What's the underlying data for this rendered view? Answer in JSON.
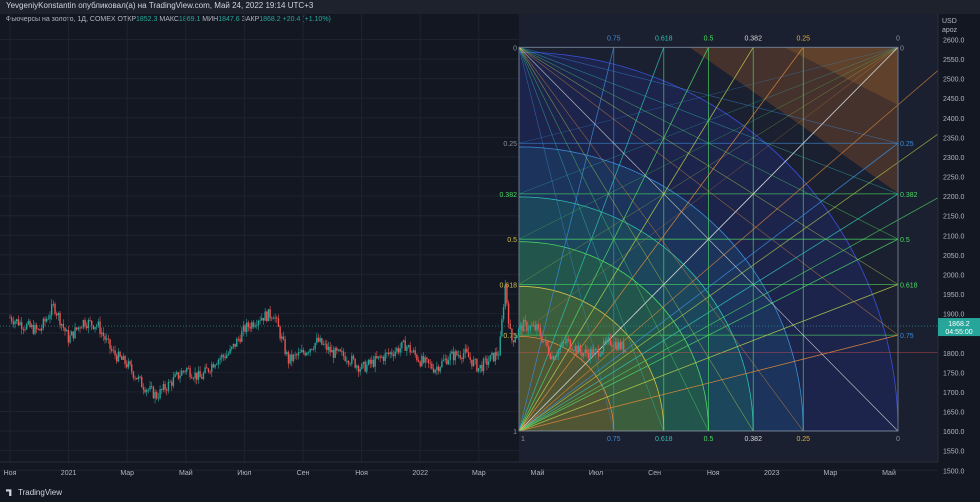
{
  "header": {
    "title": "YevgeniyKonstantin опубликовал(а) на TradingView.com, Май 24, 2022 19:14 UTC+3"
  },
  "legend": {
    "symbol": "Фьючерсы на золото, 1Д, COMEX",
    "open_label": "ОТКР",
    "open": "1852.3",
    "high_label": "МАКС",
    "high": "1869.1",
    "low_label": "МИН",
    "low": "1847.6",
    "close_label": "ЗАКР",
    "close": "1868.2",
    "change": "+20.4 (+1.10%)"
  },
  "price_axis": {
    "unit": "USD",
    "sub": "apoz",
    "last_price": "1868.2",
    "countdown": "04:55:00",
    "ticks": [
      2600,
      2550,
      2500,
      2450,
      2400,
      2350,
      2300,
      2250,
      2200,
      2150,
      2100,
      2050,
      2000,
      1950,
      1900,
      1850,
      1800,
      1750,
      1700,
      1650,
      1600,
      1550,
      1500
    ]
  },
  "footer": {
    "brand": "TradingView"
  },
  "colors": {
    "background": "#131722",
    "up": "#26a69a",
    "down": "#ef5350",
    "grid": "#1f2330",
    "price_label": "#26a69a"
  },
  "chart_data": {
    "type": "candlestick",
    "title": "",
    "symbol": "Фьючерсы на золото, 1Д, COMEX",
    "y_unit": "USD",
    "ylim": [
      1470,
      2665
    ],
    "x_tick_labels": [
      "Ноя",
      "2021",
      "Мар",
      "Май",
      "Июл",
      "Сен",
      "Ноя",
      "2022",
      "Мар",
      "Май",
      "Июл",
      "Сен",
      "Ноя",
      "2023",
      "Мар",
      "Май"
    ],
    "price_path": {
      "description_free_keypoints": true,
      "months": [
        0,
        0.5,
        1,
        1.5,
        2,
        2.5,
        3,
        3.5,
        4,
        4.5,
        5,
        5.5,
        6,
        6.5,
        7,
        7.5,
        8,
        8.5,
        9,
        9.5,
        10,
        10.5,
        11,
        11.5,
        12,
        12.5,
        13,
        13.5,
        14,
        14.5,
        15,
        15.5,
        16,
        16.5,
        17,
        17.5,
        18,
        18.5,
        19,
        19.5,
        20,
        20.5,
        21
      ],
      "close": [
        1890,
        1870,
        1855,
        1920,
        1835,
        1880,
        1870,
        1800,
        1770,
        1720,
        1690,
        1725,
        1760,
        1735,
        1780,
        1800,
        1860,
        1890,
        1900,
        1780,
        1800,
        1830,
        1800,
        1790,
        1760,
        1780,
        1800,
        1820,
        1780,
        1760,
        1790,
        1800,
        1760,
        1790,
        1820,
        1870,
        1860,
        1790,
        1830,
        1800,
        1800,
        1830,
        1810
      ]
    },
    "fan_fib_levels": [
      "0",
      "0.25",
      "0.382",
      "0.5",
      "0.618",
      "0.75",
      "1"
    ],
    "fan_fib_levels_top": [
      "0.75",
      "0.618",
      "0.5",
      "0.382",
      "0.25",
      "0"
    ],
    "fan_fib_levels_bottom": [
      "1",
      "0.75",
      "0.618",
      "0.5",
      "0.382",
      "0.25",
      "0"
    ],
    "fan_right_levels": [
      "0",
      "0.25",
      "0.382",
      "0.5",
      "0.618",
      "0.75"
    ],
    "fan_box": {
      "price_top": 2580,
      "price_bottom": 1600
    },
    "horizontal_line": 1868.2
  }
}
